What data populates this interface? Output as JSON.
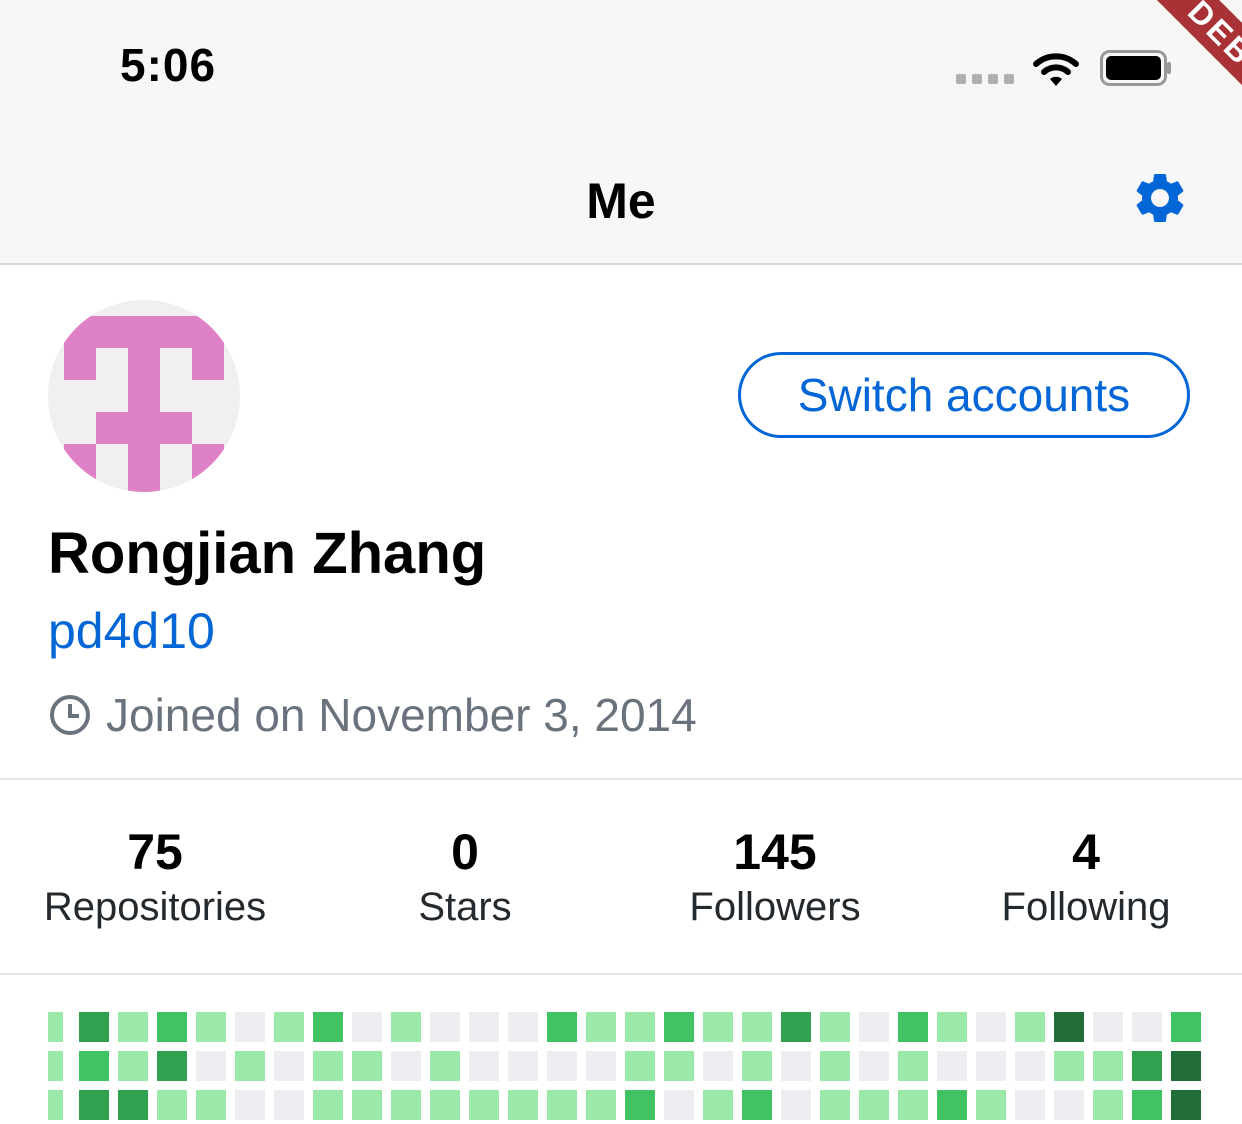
{
  "status_bar": {
    "time": "5:06",
    "signal_icon": "signal-dots-icon",
    "wifi_icon": "wifi-icon",
    "battery_icon": "battery-icon"
  },
  "debug_banner": "DEBUG",
  "nav": {
    "title": "Me",
    "settings_icon": "gear-icon",
    "accent_color": "#0366d6"
  },
  "profile": {
    "avatar_icon": "identicon-avatar",
    "avatar_color": "#df81c7",
    "switch_accounts_label": "Switch accounts",
    "name": "Rongjian Zhang",
    "login": "pd4d10",
    "joined_icon": "clock-icon",
    "joined_text": "Joined on November 3, 2014"
  },
  "stats": [
    {
      "count": "75",
      "label": "Repositories"
    },
    {
      "count": "0",
      "label": "Stars"
    },
    {
      "count": "145",
      "label": "Followers"
    },
    {
      "count": "4",
      "label": "Following"
    }
  ],
  "contributions": {
    "palette": [
      "#ebedf0",
      "#9be9a8",
      "#40c463",
      "#30a14e",
      "#216e39"
    ],
    "rows": [
      [
        1,
        3,
        1,
        2,
        1,
        0,
        1,
        2,
        0,
        1,
        0,
        0,
        0,
        2,
        1,
        1,
        2,
        1,
        1,
        3,
        1,
        0,
        2,
        1,
        0,
        1,
        4,
        0,
        0,
        2
      ],
      [
        1,
        2,
        1,
        3,
        0,
        1,
        0,
        1,
        1,
        0,
        1,
        0,
        0,
        0,
        0,
        1,
        1,
        0,
        1,
        0,
        1,
        0,
        1,
        0,
        0,
        0,
        1,
        1,
        3,
        4
      ],
      [
        1,
        3,
        3,
        1,
        1,
        0,
        0,
        1,
        1,
        1,
        1,
        1,
        1,
        1,
        1,
        2,
        0,
        1,
        2,
        0,
        1,
        1,
        1,
        2,
        1,
        0,
        0,
        1,
        2,
        4
      ]
    ]
  }
}
